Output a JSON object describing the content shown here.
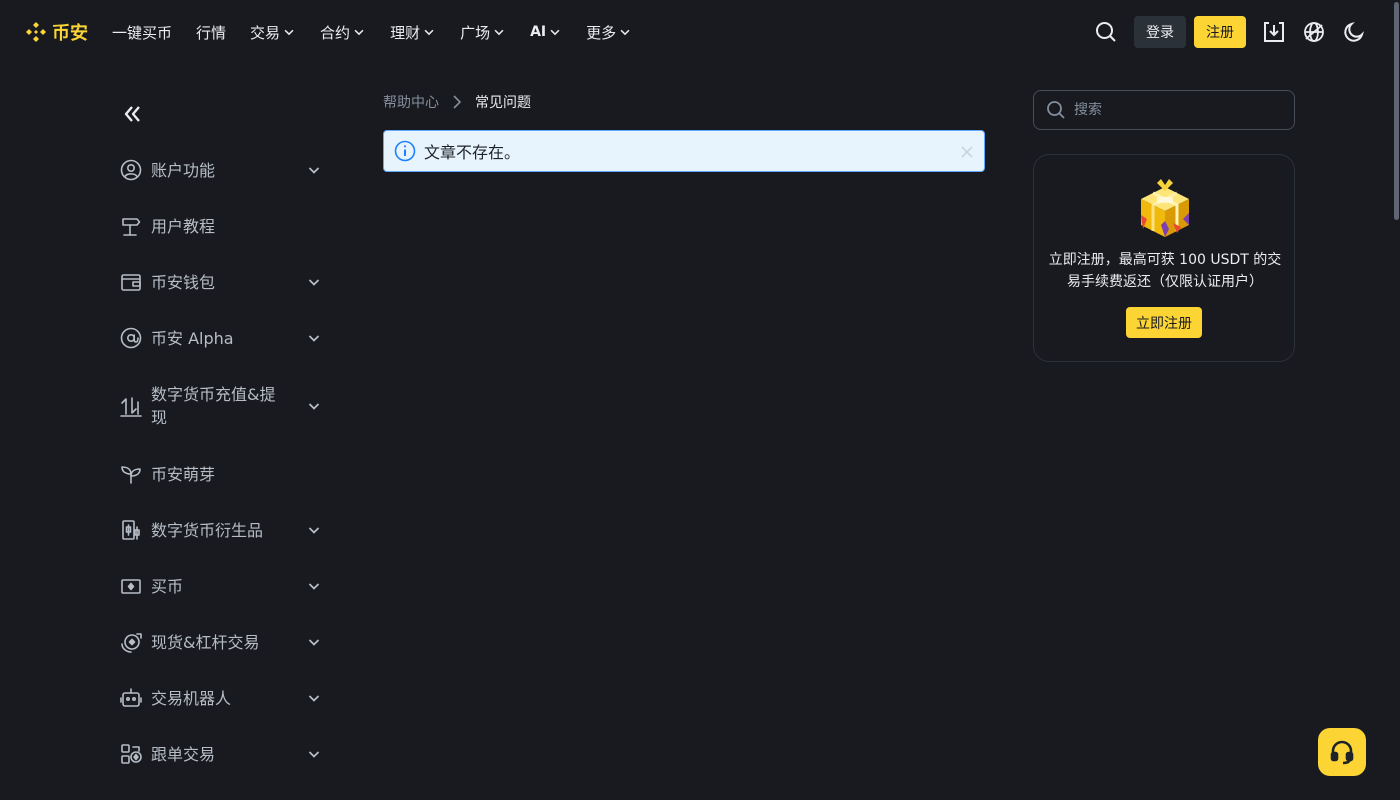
{
  "brand": {
    "logo_text": "币安",
    "accent": "#fcd535"
  },
  "nav": {
    "items": [
      {
        "label": "一键买币",
        "dropdown": false
      },
      {
        "label": "行情",
        "dropdown": false
      },
      {
        "label": "交易",
        "dropdown": true
      },
      {
        "label": "合约",
        "dropdown": true
      },
      {
        "label": "理财",
        "dropdown": true
      },
      {
        "label": "广场",
        "dropdown": true
      },
      {
        "label": "AI",
        "dropdown": true
      },
      {
        "label": "更多",
        "dropdown": true
      }
    ]
  },
  "header": {
    "login_label": "登录",
    "register_label": "注册",
    "icons": [
      "search-icon",
      "download-icon",
      "globe-icon",
      "moon-icon"
    ]
  },
  "sidebar": {
    "items": [
      {
        "label": "账户功能",
        "icon": "user-circle-icon",
        "expandable": true
      },
      {
        "label": "用户教程",
        "icon": "signpost-icon",
        "expandable": false
      },
      {
        "label": "币安钱包",
        "icon": "wallet-icon",
        "expandable": true
      },
      {
        "label": "币安 Alpha",
        "icon": "at-icon",
        "expandable": true
      },
      {
        "label": "数字货币充值&提现",
        "icon": "deposit-withdraw-icon",
        "expandable": true
      },
      {
        "label": "币安萌芽",
        "icon": "sprout-icon",
        "expandable": false
      },
      {
        "label": "数字货币衍生品",
        "icon": "derivatives-icon",
        "expandable": true
      },
      {
        "label": "买币",
        "icon": "cash-icon",
        "expandable": true
      },
      {
        "label": "现货&杠杆交易",
        "icon": "spot-margin-icon",
        "expandable": true
      },
      {
        "label": "交易机器人",
        "icon": "robot-icon",
        "expandable": true
      },
      {
        "label": "跟单交易",
        "icon": "copy-trading-icon",
        "expandable": true
      }
    ]
  },
  "breadcrumb": {
    "home": "帮助中心",
    "current": "常见问题"
  },
  "alert": {
    "message": "文章不存在。"
  },
  "search": {
    "placeholder": "搜索"
  },
  "promo": {
    "text": "立即注册，最高可获 100 USDT 的交易手续费返还（仅限认证用户）",
    "button_label": "立即注册"
  }
}
